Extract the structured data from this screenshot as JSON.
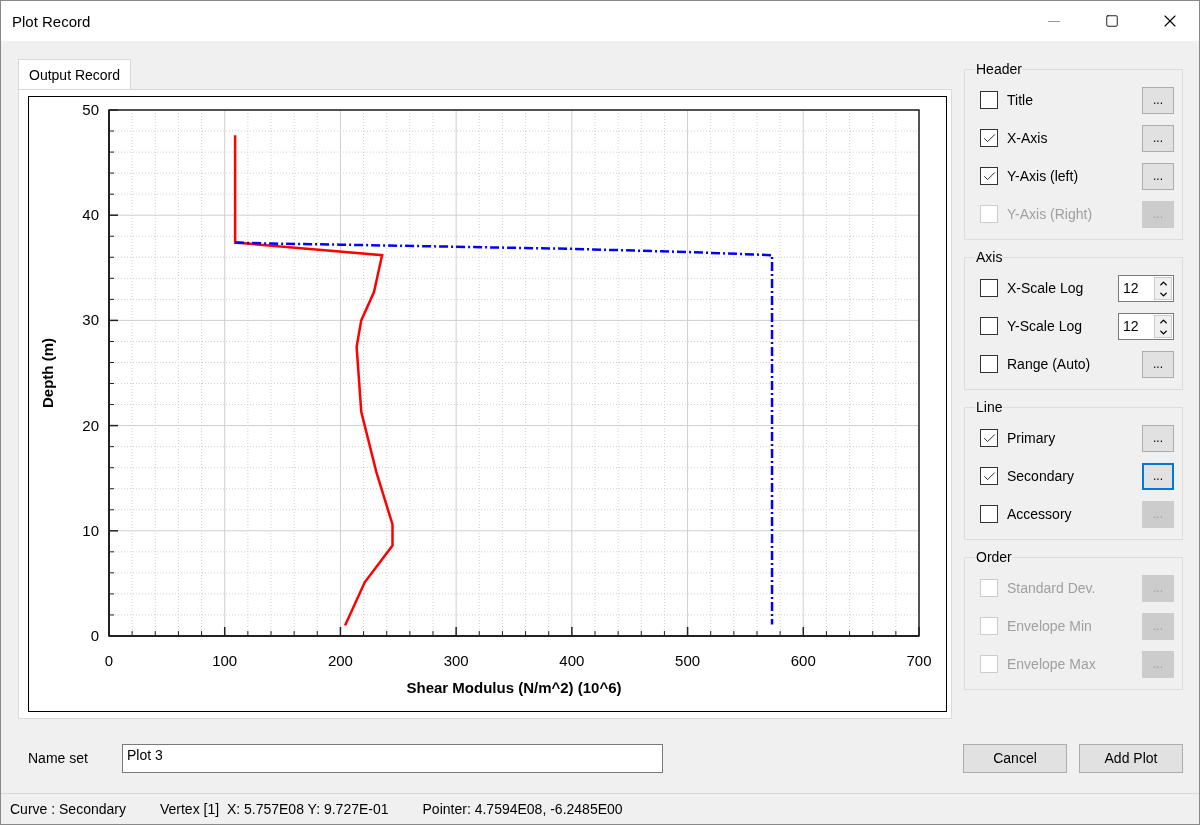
{
  "window": {
    "title": "Plot Record"
  },
  "tabs": [
    {
      "label": "Output Record",
      "selected": true
    }
  ],
  "chart": {
    "chart_data": {
      "type": "line",
      "xlabel": "Shear Modulus (N/m^2) (10^6)",
      "ylabel": "Depth (m)",
      "xlim": [
        0,
        700
      ],
      "ylim": [
        0,
        50
      ],
      "xticks": [
        0,
        100,
        200,
        300,
        400,
        500,
        600,
        700
      ],
      "yticks": [
        0,
        10,
        20,
        30,
        40,
        50
      ],
      "grid": true,
      "series": [
        {
          "color": "#ff0000",
          "line_style": "solid",
          "x": [
            109,
            109,
            236,
            229,
            218,
            214,
            218,
            231,
            245,
            245,
            221,
            204
          ],
          "values": [
            47.6,
            37.4,
            36.2,
            32.7,
            30,
            27.5,
            21.3,
            15.6,
            10.6,
            8.6,
            5.1,
            1.0
          ]
        },
        {
          "color": "#0000ff",
          "line_style": "dashdot",
          "x": [
            109,
            140,
            200,
            300,
            400,
            500,
            573,
            573
          ],
          "values": [
            37.4,
            37.3,
            37.2,
            37.0,
            36.8,
            36.5,
            36.2,
            1.1
          ]
        }
      ]
    }
  },
  "groups": [
    {
      "title": "Header",
      "rows": [
        {
          "kind": "button",
          "label": "Title",
          "checked": false,
          "disabled": false,
          "button": "...",
          "focused": false,
          "button_disabled": false
        },
        {
          "kind": "button",
          "label": "X-Axis",
          "checked": true,
          "disabled": false,
          "button": "...",
          "focused": false,
          "button_disabled": false
        },
        {
          "kind": "button",
          "label": "Y-Axis (left)",
          "checked": true,
          "disabled": false,
          "button": "...",
          "focused": false,
          "button_disabled": false
        },
        {
          "kind": "button",
          "label": "Y-Axis (Right)",
          "checked": false,
          "disabled": true,
          "button": "...",
          "focused": false,
          "button_disabled": true
        }
      ]
    },
    {
      "title": "Axis",
      "rows": [
        {
          "kind": "spinner",
          "label": "X-Scale Log",
          "checked": false,
          "disabled": false,
          "value": "12"
        },
        {
          "kind": "spinner",
          "label": "Y-Scale Log",
          "checked": false,
          "disabled": false,
          "value": "12"
        },
        {
          "kind": "button",
          "label": "Range (Auto)",
          "checked": false,
          "disabled": false,
          "button": "...",
          "focused": false,
          "button_disabled": false
        }
      ]
    },
    {
      "title": "Line",
      "rows": [
        {
          "kind": "button",
          "label": "Primary",
          "checked": true,
          "disabled": false,
          "button": "...",
          "focused": false,
          "button_disabled": false
        },
        {
          "kind": "button",
          "label": "Secondary",
          "checked": true,
          "disabled": false,
          "button": "...",
          "focused": true,
          "button_disabled": false
        },
        {
          "kind": "button",
          "label": "Accessory",
          "checked": false,
          "disabled": false,
          "button": "...",
          "focused": false,
          "button_disabled": true
        }
      ]
    },
    {
      "title": "Order",
      "rows": [
        {
          "kind": "button",
          "label": "Standard Dev.",
          "checked": false,
          "disabled": true,
          "button": "...",
          "focused": false,
          "button_disabled": true
        },
        {
          "kind": "button",
          "label": "Envelope Min",
          "checked": false,
          "disabled": true,
          "button": "...",
          "focused": false,
          "button_disabled": true
        },
        {
          "kind": "button",
          "label": "Envelope Max",
          "checked": false,
          "disabled": true,
          "button": "...",
          "focused": false,
          "button_disabled": true
        }
      ]
    }
  ],
  "name_set": {
    "label": "Name set",
    "value": "Plot 3"
  },
  "buttons": [
    "Cancel",
    "Add Plot"
  ],
  "status_bar": [
    "Curve : Secondary",
    "Vertex [1]  X: 5.757E08 Y: 9.727E-01",
    "Pointer: 4.7594E08, -6.2485E00"
  ]
}
